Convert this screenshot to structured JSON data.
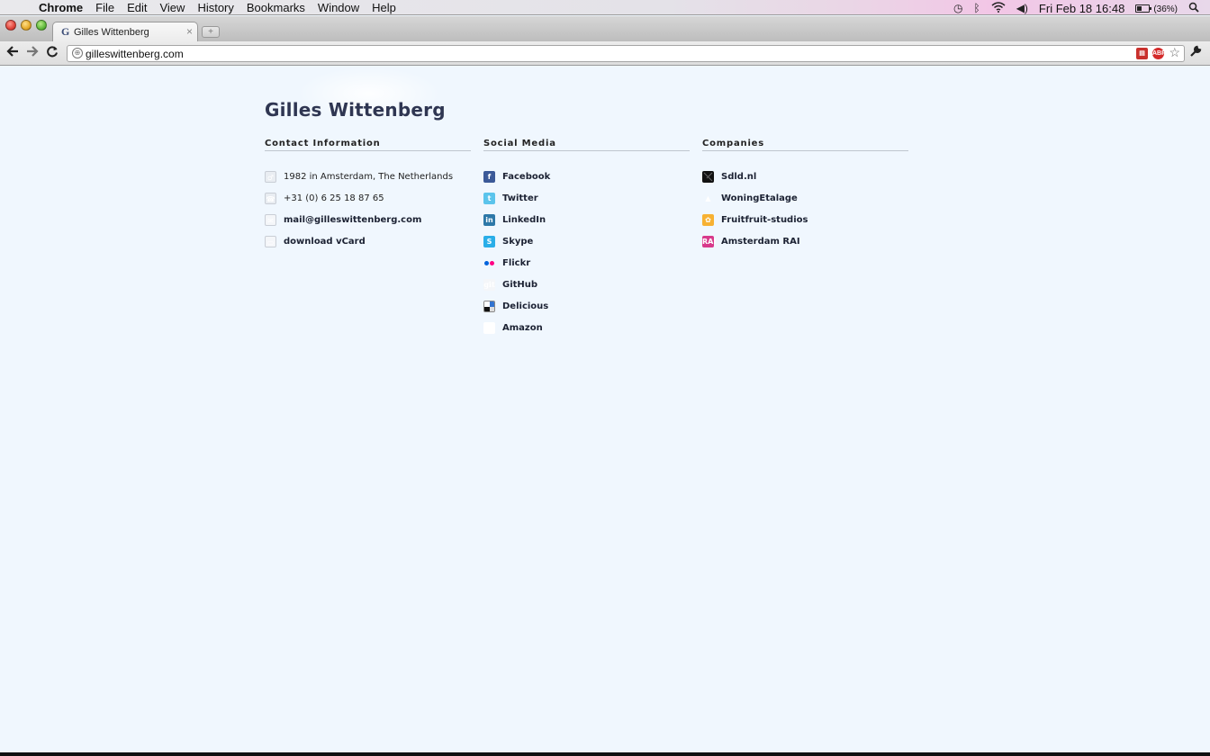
{
  "menubar": {
    "apple_symbol": "",
    "app_name": "Chrome",
    "menus": [
      "File",
      "Edit",
      "View",
      "History",
      "Bookmarks",
      "Window",
      "Help"
    ],
    "clock": "Fri Feb 18  16:48",
    "battery": "(36%)"
  },
  "browser": {
    "tab_title": "Gilles Wittenberg",
    "tab_favicon": "G",
    "tab_close": "×",
    "new_tab": "+",
    "url": "gilleswittenberg.com"
  },
  "page": {
    "name": "Gilles Wittenberg",
    "contact": {
      "heading": "Contact Information",
      "items": [
        {
          "icon": "male-icon",
          "text": "1982 in Amsterdam, The Netherlands"
        },
        {
          "icon": "phone-icon",
          "text": "+31 (0) 6 25 18 87 65"
        },
        {
          "icon": "mail-icon",
          "text": "mail@gilleswittenberg.com"
        },
        {
          "icon": "vcard-icon",
          "text": "download vCard"
        }
      ]
    },
    "social": {
      "heading": "Social Media",
      "items": [
        {
          "icon": "facebook-icon",
          "text": "Facebook"
        },
        {
          "icon": "twitter-icon",
          "text": "Twitter"
        },
        {
          "icon": "linkedin-icon",
          "text": "LinkedIn"
        },
        {
          "icon": "skype-icon",
          "text": "Skype"
        },
        {
          "icon": "flickr-icon",
          "text": "Flickr"
        },
        {
          "icon": "github-icon",
          "text": "GitHub"
        },
        {
          "icon": "delicious-icon",
          "text": "Delicious"
        },
        {
          "icon": "amazon-icon",
          "text": "Amazon"
        }
      ]
    },
    "companies": {
      "heading": "Companies",
      "items": [
        {
          "icon": "sdld-icon",
          "text": "Sdld.nl"
        },
        {
          "icon": "woningetalage-icon",
          "text": "WoningEtalage"
        },
        {
          "icon": "fruitfruit-icon",
          "text": "Fruitfruit-studios"
        },
        {
          "icon": "rai-icon",
          "text": "Amsterdam RAI"
        }
      ]
    }
  },
  "colors": {
    "page_background": "#f0f7fe",
    "name_text": "#2f3652",
    "facebook": "#3b5998",
    "twitter": "#5bc4ec",
    "linkedin": "#2d78a8",
    "skype": "#2aaee8",
    "rai": "#d83a8b",
    "fruitfruit": "#f7b132"
  }
}
